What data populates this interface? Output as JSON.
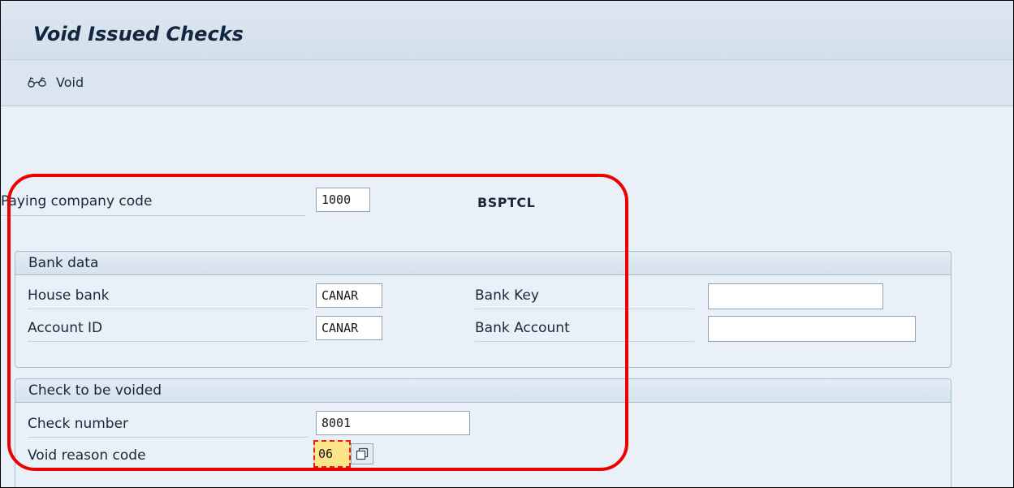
{
  "window": {
    "title": "Void Issued Checks"
  },
  "toolbar": {
    "void_label": "Void",
    "void_icon": "glasses-icon"
  },
  "header": {
    "paying_company_code_label": "Paying company code",
    "paying_company_code_value": "1000",
    "company_name": "BSPTCL"
  },
  "bank_data": {
    "title": "Bank data",
    "house_bank_label": "House bank",
    "house_bank_value": "CANAR",
    "account_id_label": "Account ID",
    "account_id_value": "CANAR",
    "bank_key_label": "Bank Key",
    "bank_key_value": "",
    "bank_account_label": "Bank Account",
    "bank_account_value": ""
  },
  "check": {
    "title": "Check to be voided",
    "check_number_label": "Check number",
    "check_number_value": "8001",
    "void_reason_label": "Void reason code",
    "void_reason_value": "06"
  },
  "colors": {
    "highlight": "#ec0000",
    "focused_field": "#fbe48a"
  }
}
